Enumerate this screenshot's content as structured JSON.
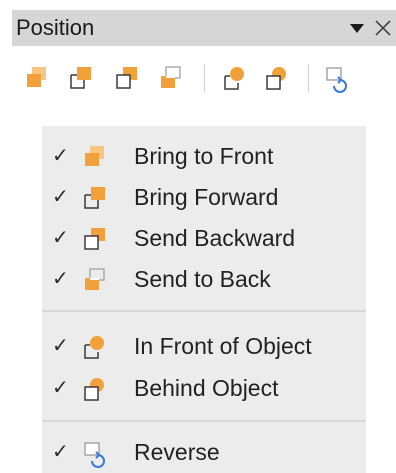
{
  "panel": {
    "title": "Position",
    "controls": {
      "dropdown_icon": "triangle-down-icon",
      "close_icon": "close-icon"
    }
  },
  "toolbar": {
    "buttons": [
      {
        "icon": "bring-to-front-icon"
      },
      {
        "icon": "bring-forward-icon"
      },
      {
        "icon": "send-backward-icon"
      },
      {
        "icon": "send-to-back-icon"
      },
      {
        "icon": "in-front-of-object-icon"
      },
      {
        "icon": "behind-object-icon"
      },
      {
        "icon": "reverse-icon"
      }
    ]
  },
  "menu": {
    "groups": [
      {
        "items": [
          {
            "label": "Bring to Front",
            "checked": true,
            "icon": "bring-to-front-icon"
          },
          {
            "label": "Bring Forward",
            "checked": true,
            "icon": "bring-forward-icon"
          },
          {
            "label": "Send Backward",
            "checked": true,
            "icon": "send-backward-icon"
          },
          {
            "label": "Send to Back",
            "checked": true,
            "icon": "send-to-back-icon"
          }
        ]
      },
      {
        "items": [
          {
            "label": "In Front of Object",
            "checked": true,
            "icon": "in-front-of-object-icon"
          },
          {
            "label": "Behind Object",
            "checked": true,
            "icon": "behind-object-icon"
          }
        ]
      },
      {
        "items": [
          {
            "label": "Reverse",
            "checked": true,
            "icon": "reverse-icon"
          }
        ]
      }
    ],
    "check_glyph": "✓"
  },
  "colors": {
    "accent_orange": "#f2a13a",
    "accent_orange_light": "#f7c680",
    "outline": "#3a3a3a",
    "outline_light": "#a0a0a0",
    "reverse_blue": "#3b7ad9",
    "titlebar_bg": "#d6d6d6",
    "menu_bg": "#ececec"
  }
}
